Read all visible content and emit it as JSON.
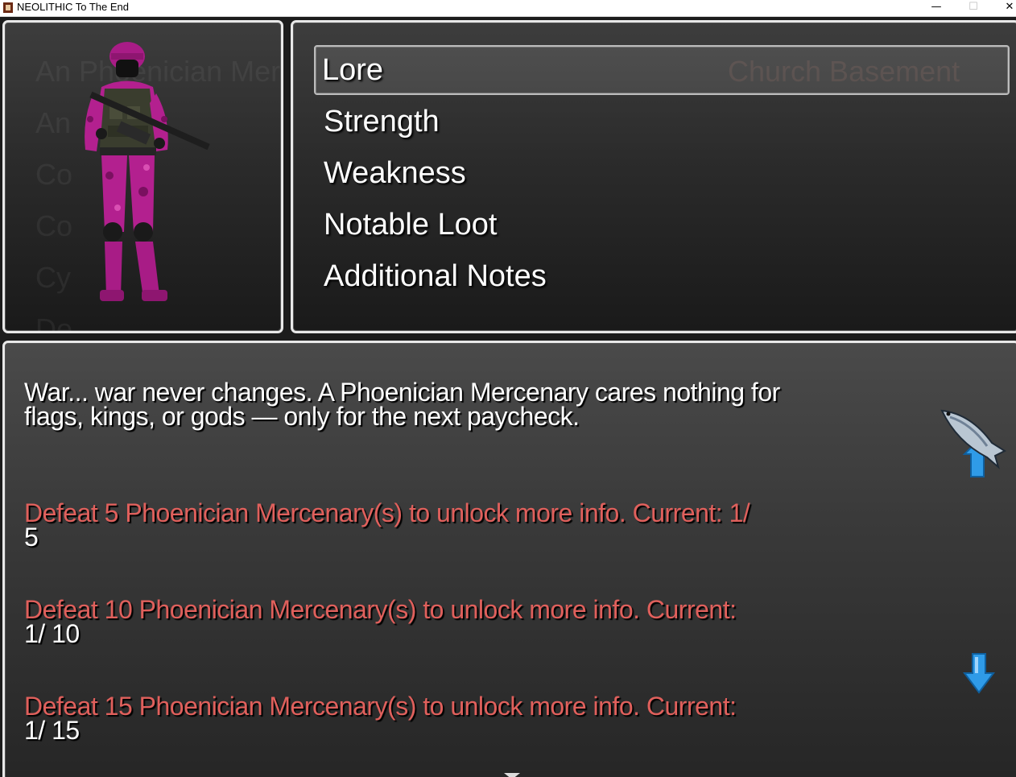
{
  "window": {
    "title": "NEOLITHIC To The End",
    "minimize_glyph": "—",
    "maximize_glyph": "☐",
    "close_glyph": "✕"
  },
  "menu": {
    "items": [
      {
        "label": "Lore",
        "selected": true
      },
      {
        "label": "Strength",
        "selected": false
      },
      {
        "label": "Weakness",
        "selected": false
      },
      {
        "label": "Notable Loot",
        "selected": false
      },
      {
        "label": "Additional Notes",
        "selected": false
      }
    ]
  },
  "background_text": {
    "left_list": [
      "An Phoenician Mercenary",
      "An",
      "Co",
      "Co",
      "Cy",
      "De"
    ],
    "right_location": "Church Basement"
  },
  "info": {
    "lore_text": "War... war never changes. A Phoenician Mercenary cares nothing for\nflags, kings, or gods — only for the next paycheck.",
    "unlocks": [
      {
        "text": "Defeat 5 Phoenician Mercenary(s) to unlock more info. Current: 1/",
        "current": "5"
      },
      {
        "text": "Defeat 10 Phoenician Mercenary(s) to unlock more info. Current:",
        "current": "1/ 10"
      },
      {
        "text": "Defeat 15 Phoenician Mercenary(s) to unlock more info. Current:",
        "current": "1/ 15"
      }
    ]
  },
  "icons": {
    "scroll_up": "fish-up-arrow-icon",
    "scroll_down": "down-arrow-icon",
    "more": "down-caret-icon"
  },
  "colors": {
    "unlock_text": "#e0605c",
    "soldier_camo": "#b3208f",
    "arrow_blue": "#2f9be8"
  }
}
